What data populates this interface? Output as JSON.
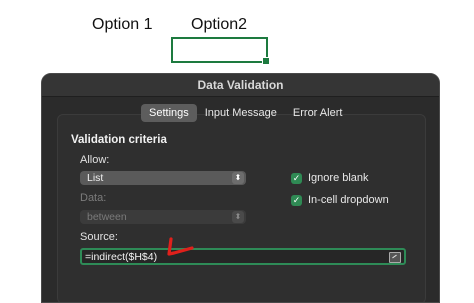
{
  "sheet": {
    "header_option1": "Option 1",
    "header_option2": "Option2"
  },
  "dialog": {
    "title": "Data Validation",
    "tabs": [
      {
        "label": "Settings",
        "active": true
      },
      {
        "label": "Input Message",
        "active": false
      },
      {
        "label": "Error Alert",
        "active": false
      }
    ],
    "section_title": "Validation criteria",
    "allow_label": "Allow:",
    "allow_value": "List",
    "data_label": "Data:",
    "data_value": "between",
    "ignore_blank_label": "Ignore blank",
    "ignore_blank_checked": true,
    "incell_dropdown_label": "In-cell dropdown",
    "incell_dropdown_checked": true,
    "source_label": "Source:",
    "source_value": "=indirect($H$4)"
  },
  "colors": {
    "accent_green": "#2e8b57",
    "annotation_red": "#e0201b",
    "dialog_bg": "#2b2b2b"
  }
}
